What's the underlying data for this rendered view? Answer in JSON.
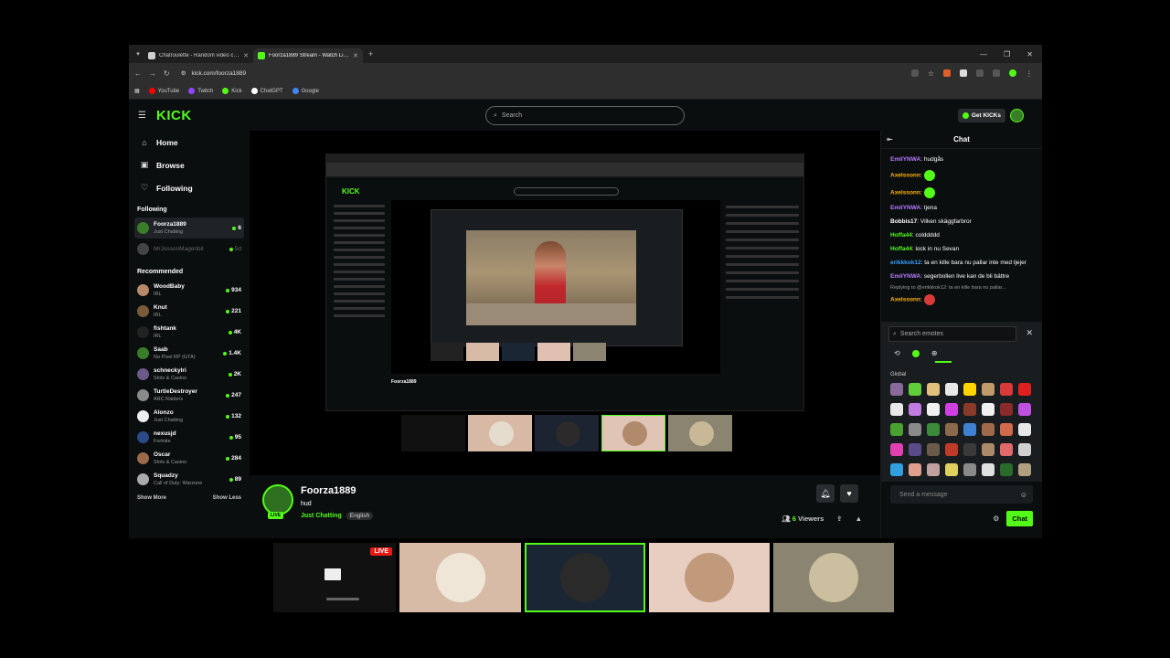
{
  "browser": {
    "tabs": [
      {
        "title": "Chatroulette - Random video chat",
        "favicon_color": "#cfcfcf",
        "active": false
      },
      {
        "title": "Foorza1889 Stream - Watch Live on Kick",
        "favicon_color": "#53fc18",
        "active": true
      }
    ],
    "url": "kick.com/foorza1889",
    "bookmarks": [
      {
        "label": "YouTube",
        "color": "#ff0000"
      },
      {
        "label": "Twitch",
        "color": "#9146ff"
      },
      {
        "label": "Kick",
        "color": "#53fc18"
      },
      {
        "label": "ChatGPT",
        "color": "#ffffff"
      },
      {
        "label": "Google",
        "color": "#4285f4"
      }
    ]
  },
  "kick": {
    "logo": "KICK",
    "search_placeholder": "Search",
    "get_kicks_label": "Get KICKs",
    "nav": [
      {
        "label": "Home",
        "icon": "home-icon",
        "glyph": "⌂"
      },
      {
        "label": "Browse",
        "icon": "browse-icon",
        "glyph": "▣"
      },
      {
        "label": "Following",
        "icon": "heart-icon",
        "glyph": "♡"
      }
    ],
    "following_title": "Following",
    "following": [
      {
        "name": "Foorza1889",
        "category": "Just Chatting",
        "viewers": "6",
        "color": "#3a7d28",
        "selected": true,
        "offline": false
      },
      {
        "name": "MrJossonMagenbil",
        "category": "",
        "viewers": "5d",
        "color": "#444444",
        "selected": false,
        "offline": true
      }
    ],
    "recommended_title": "Recommended",
    "recommended": [
      {
        "name": "WoodBaby",
        "category": "IRL",
        "viewers": "934",
        "color": "#b98a6a"
      },
      {
        "name": "Knut",
        "category": "IRL",
        "viewers": "221",
        "color": "#7a5a3a"
      },
      {
        "name": "fishtank",
        "category": "IRL",
        "viewers": "4K",
        "color": "#222222"
      },
      {
        "name": "Saab",
        "category": "No Pixel RP (GTA)",
        "viewers": "1.4K",
        "color": "#3a7d28"
      },
      {
        "name": "schneckylri",
        "category": "Slots & Casino",
        "viewers": "2K",
        "color": "#6a5a8a"
      },
      {
        "name": "TurtleDestroyer",
        "category": "ARC Raiders",
        "viewers": "247",
        "color": "#8a8a8a"
      },
      {
        "name": "Alonzo",
        "category": "Just Chatting",
        "viewers": "132",
        "color": "#eeeeee"
      },
      {
        "name": "nexusjd",
        "category": "Fortnite",
        "viewers": "95",
        "color": "#2a4a8a"
      },
      {
        "name": "Oscar",
        "category": "Slots & Casino",
        "viewers": "284",
        "color": "#9a6a4a"
      },
      {
        "name": "Squadzy",
        "category": "Call of Duty: Warzone",
        "viewers": "89",
        "color": "#aaaaaa"
      }
    ],
    "show_more": "Show More",
    "show_less": "Show Less",
    "stream": {
      "name": "Foorza1889",
      "title": "hud",
      "category": "Just Chatting",
      "language": "English",
      "live": "LIVE",
      "viewers": "6",
      "viewers_label": "Viewers"
    },
    "chat": {
      "title": "Chat",
      "messages": [
        {
          "user": "EmilYNWA",
          "color": "#b77bff",
          "text": "hudgås"
        },
        {
          "user": "Axelssonn",
          "color": "#ffb300",
          "text": "",
          "emote": true
        },
        {
          "user": "Axelssonn",
          "color": "#ffb300",
          "text": "",
          "emote": true
        },
        {
          "user": "EmilYNWA",
          "color": "#b77bff",
          "text": "tjena"
        },
        {
          "user": "Bobbis17",
          "color": "#ffffff",
          "text": "Vilken skäggfarbror"
        },
        {
          "user": "Hoffa44",
          "color": "#53fc18",
          "text": "colddddd"
        },
        {
          "user": "Hoffa44",
          "color": "#53fc18",
          "text": "lock in nu Sevan"
        },
        {
          "user": "erikkkok12",
          "color": "#3aa0ff",
          "text": "ta en kille bara nu pallar inte med tjejer"
        },
        {
          "user": "EmilYNWA",
          "color": "#b77bff",
          "text": "segerbollen live kan de bli bättre"
        }
      ],
      "reply_note": "Replying to @erikkkok12: ta en kille bara nu pallar...",
      "last_user": "Axelssonn",
      "emote_search_placeholder": "Search emotes",
      "global_label": "Global",
      "emote_colors": [
        "#8a6a9a",
        "#5fcf3a",
        "#e0c07a",
        "#e8e8e8",
        "#ffd400",
        "#c09a6a",
        "#d83a3a",
        "#e02020",
        "#e8e8e8",
        "#c07ae0",
        "#f0f0f0",
        "#d040e0",
        "#8a3a2a",
        "#f0f0f0",
        "#8a2a2a",
        "#c050e0",
        "#4aa030",
        "#8a8a8a",
        "#3a8a3a",
        "#8a6a4a",
        "#4080d0",
        "#a06a4a",
        "#d06a4a",
        "#e8e8e8",
        "#e040b0",
        "#5a4a8a",
        "#6a5a4a",
        "#c03a2a",
        "#3a3a3a",
        "#aa8a6a",
        "#e06a6a",
        "#d0d0d0",
        "#30a0e0",
        "#e0a090",
        "#c0a0a0",
        "#e0d060",
        "#8a8a8a",
        "#e0e0e0",
        "#2a6a2a",
        "#b0a080"
      ],
      "input_placeholder": "Send a message",
      "send_label": "Chat"
    }
  },
  "strip": {
    "live": "LIVE",
    "colors": [
      "#111111",
      "#d8bba6",
      "#1b2634",
      "#e8cdc1",
      "#8a8470"
    ]
  }
}
